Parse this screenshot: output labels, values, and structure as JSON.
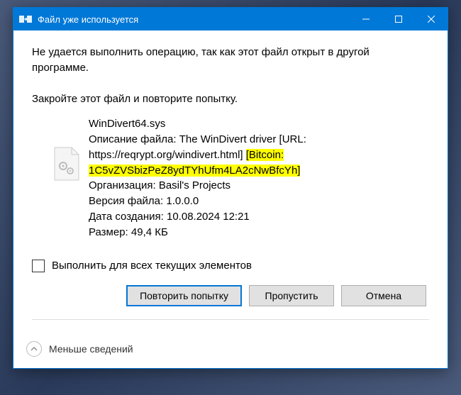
{
  "titlebar": {
    "title": "Файл уже используется"
  },
  "content": {
    "msg1": "Не удается выполнить операцию, так как этот файл открыт в другой программе.",
    "msg2": "Закройте этот файл и повторите попытку.",
    "file": {
      "name": "WinDivert64.sys",
      "desc_label": "Описание файла: ",
      "desc_value_pre": "The WinDivert driver [URL: https://reqrypt.org/windivert.html] ",
      "bitcoin_hl": "[Bitcoin: 1C5vZVSbizPeZ8ydTYhUfm4LA2cNwBfcYh]",
      "org_label": "Организация: ",
      "org_value": "Basil's Projects",
      "ver_label": "Версия файла: ",
      "ver_value": "1.0.0.0",
      "date_label": "Дата создания: ",
      "date_value": "10.08.2024 12:21",
      "size_label": "Размер: ",
      "size_value": "49,4 КБ"
    },
    "checkbox_label": "Выполнить для всех текущих элементов",
    "buttons": {
      "retry": "Повторить попытку",
      "skip": "Пропустить",
      "cancel": "Отмена"
    }
  },
  "footer": {
    "less": "Меньше сведений"
  }
}
